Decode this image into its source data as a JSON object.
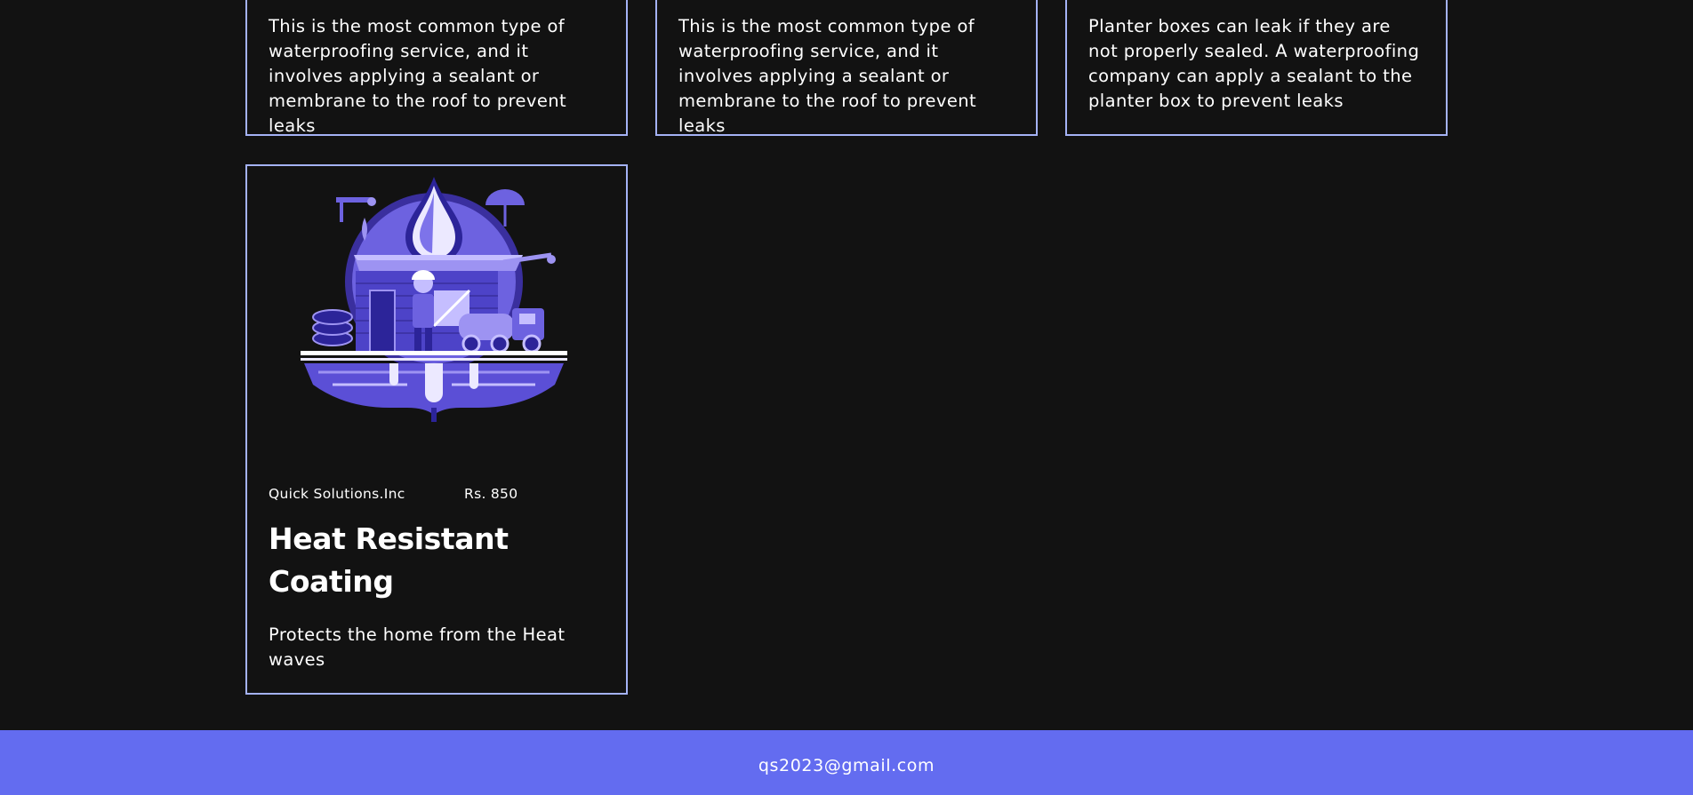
{
  "services": [
    {
      "description": "This is the most common type of waterproofing service, and it involves applying a sealant or membrane to the roof to prevent leaks"
    },
    {
      "description": "This is the most common type of waterproofing service, and it involves applying a sealant or membrane to the roof to prevent leaks"
    },
    {
      "description": "Planter boxes can leak if they are not properly sealed. A waterproofing company can apply a sealant to the planter box to prevent leaks"
    },
    {
      "image_icon": "waterproofing-illustration",
      "company": "Quick Solutions.Inc",
      "price": "Rs. 850",
      "title": "Heat Resistant Coating",
      "description": "Protects the home from the Heat waves"
    }
  ],
  "footer": {
    "email": "qs2023@gmail.com"
  },
  "colors": {
    "background": "#121212",
    "card_border": "#a4b2f5",
    "accent": "#636cf0",
    "illustration_primary": "#5b4fd6",
    "illustration_light": "#9d93f2"
  }
}
